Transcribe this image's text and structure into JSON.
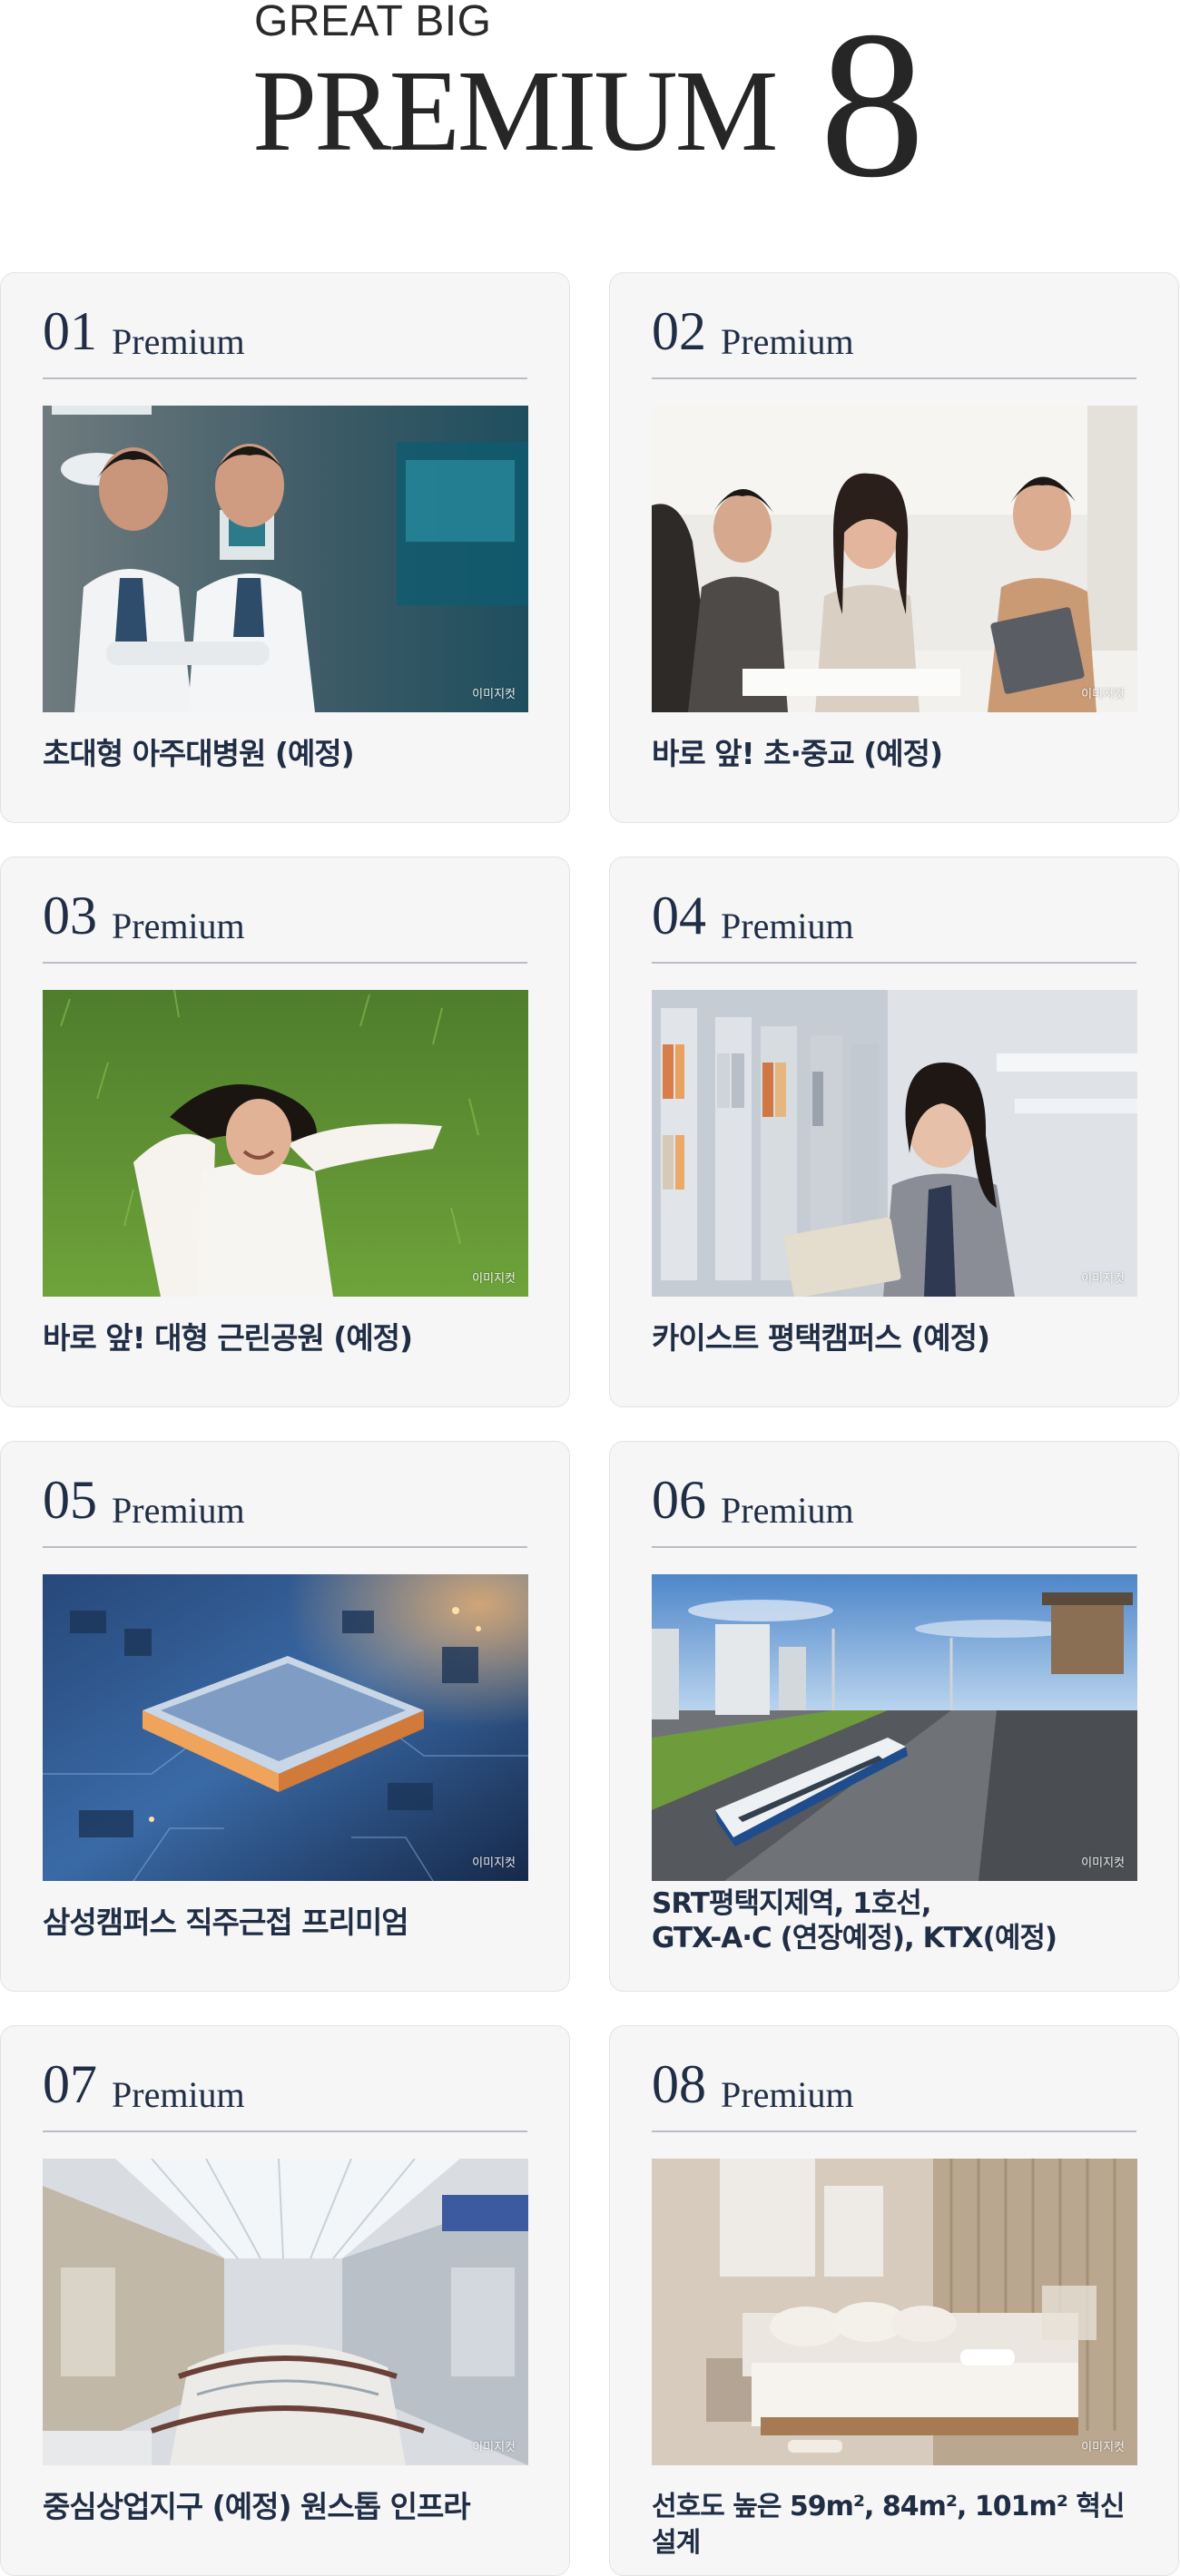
{
  "header": {
    "kicker": "GREAT BIG",
    "title": "PREMIUM",
    "number": "8"
  },
  "cards": [
    {
      "no": "01",
      "label": "Premium",
      "caption": "초대형 아주대병원 (예정)",
      "watermark": "이미지컷",
      "photo": "doctors"
    },
    {
      "no": "02",
      "label": "Premium",
      "caption": "바로 앞! 초·중교 (예정)",
      "watermark": "이미지컷",
      "photo": "students"
    },
    {
      "no": "03",
      "label": "Premium",
      "caption": "바로 앞! 대형 근린공원 (예정)",
      "watermark": "이미지컷",
      "photo": "grass-woman"
    },
    {
      "no": "04",
      "label": "Premium",
      "caption": "카이스트 평택캠퍼스 (예정)",
      "watermark": "이미지컷",
      "photo": "library-student"
    },
    {
      "no": "05",
      "label": "Premium",
      "caption": "삼성캠퍼스 직주근접 프리미엄",
      "watermark": "이미지컷",
      "photo": "semiconductor-chip"
    },
    {
      "no": "06",
      "label": "Premium",
      "caption_line1": "SRT평택지제역, 1호선,",
      "caption_line2": "GTX-A·C (연장예정), KTX(예정)",
      "watermark": "이미지컷",
      "photo": "train-station"
    },
    {
      "no": "07",
      "label": "Premium",
      "caption": "중심상업지구 (예정) 원스톱 인프라",
      "watermark": "이미지컷",
      "photo": "shopping-mall"
    },
    {
      "no": "08",
      "label": "Premium",
      "caption": "선호도 높은 59m², 84m², 101m² 혁신 설계",
      "watermark": "이미지컷",
      "photo": "bedroom"
    }
  ]
}
